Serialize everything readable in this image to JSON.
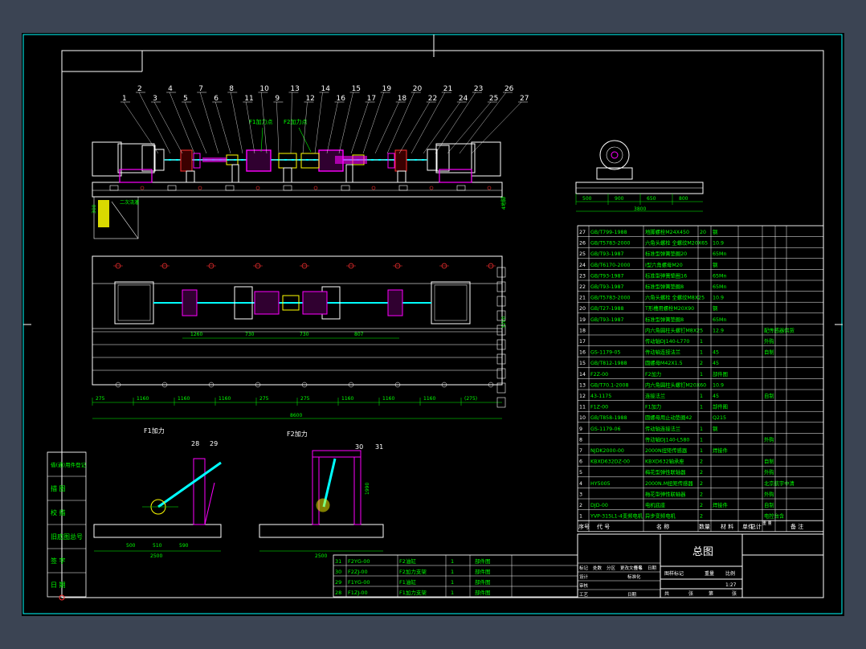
{
  "colors": {
    "background": "#000000",
    "border": "#ffffff",
    "annotation": "#00ff00",
    "balloon": "#ffff00",
    "hatch": "#ffff00",
    "flange": "#ff00ff",
    "frame_cyan": "#00ffff",
    "red": "#ff3030"
  },
  "balloons": [
    "1",
    "2",
    "3",
    "4",
    "5",
    "7",
    "6",
    "8",
    "11",
    "10",
    "9",
    "13",
    "12",
    "14",
    "16",
    "15",
    "17",
    "19",
    "18",
    "20",
    "22",
    "21",
    "24",
    "23",
    "25",
    "26",
    "27"
  ],
  "annotations": {
    "f1_load_point": "F1加力点",
    "f2_load_point": "F2加力点",
    "second_pour": "二次浇灌",
    "base_label": "300",
    "wall_label": "4地脚"
  },
  "dims_side": [
    "500",
    "900",
    "650",
    "800"
  ],
  "dims_side_total": "3800",
  "dims_plan_top": [
    "1260",
    "730",
    "730",
    "807"
  ],
  "dims_plan_bottom": [
    "275",
    "1160",
    "1160",
    "1160",
    "275",
    "275",
    "1160",
    "1160",
    "1160",
    "(275)"
  ],
  "dims_plan_total": "8600",
  "dims_plan_right": "3200",
  "f1_view": {
    "title": "F1加力",
    "balloons": [
      "28",
      "29"
    ],
    "dims": [
      "500",
      "510",
      "590"
    ],
    "total": "2500"
  },
  "f2_view": {
    "title": "F2加力",
    "balloons": [
      "30",
      "31"
    ],
    "height": "1990",
    "total": "2500"
  },
  "left_block": [
    "借(通)用件登记",
    "描  图",
    "校  描",
    "旧底图总号",
    "签  字",
    "日  期"
  ],
  "bom_rows": [
    {
      "no": "27",
      "code": "GB/T799-1988",
      "name": "地脚螺栓M24X450",
      "qty": "20",
      "mat": "钢",
      "note1": "",
      "note2": ""
    },
    {
      "no": "26",
      "code": "GB/T5783-2000",
      "name": "六角头螺栓 全螺纹M20X65",
      "qty": "",
      "mat": "10.9",
      "note1": "",
      "note2": ""
    },
    {
      "no": "25",
      "code": "GB/T93-1987",
      "name": "标准型弹簧垫圈20",
      "qty": "",
      "mat": "65Mn",
      "note1": "",
      "note2": ""
    },
    {
      "no": "24",
      "code": "GB/T6170-2000",
      "name": "I型六角螺母M20",
      "qty": "",
      "mat": "钢",
      "note1": "",
      "note2": ""
    },
    {
      "no": "23",
      "code": "GB/T93-1987",
      "name": "标准型弹簧垫圈16",
      "qty": "",
      "mat": "65Mn",
      "note1": "",
      "note2": ""
    },
    {
      "no": "22",
      "code": "GB/T93-1987",
      "name": "标准型弹簧垫圈8",
      "qty": "",
      "mat": "65Mn",
      "note1": "",
      "note2": ""
    },
    {
      "no": "21",
      "code": "GB/T5783-2000",
      "name": "六角头螺栓 全螺纹M8X25",
      "qty": "",
      "mat": "10.9",
      "note1": "",
      "note2": ""
    },
    {
      "no": "20",
      "code": "GB/T27-1988",
      "name": "T形槽用螺栓M20X90",
      "qty": "",
      "mat": "钢",
      "note1": "",
      "note2": ""
    },
    {
      "no": "19",
      "code": "GB/T93-1987",
      "name": "标准型弹簧垫圈8",
      "qty": "",
      "mat": "65Mn",
      "note1": "",
      "note2": ""
    },
    {
      "no": "18",
      "code": "",
      "name": "内六角圆柱头螺钉M8X25",
      "qty": "",
      "mat": "12.9",
      "note1": "",
      "note2": "配传感器供货"
    },
    {
      "no": "17",
      "code": "",
      "name": "传动轴DJ140-L770",
      "qty": "1",
      "mat": "",
      "note1": "",
      "note2": "外购"
    },
    {
      "no": "16",
      "code": "GS-1179-05",
      "name": "传动轴连接法兰",
      "qty": "1",
      "mat": "45",
      "note1": "",
      "note2": "自制"
    },
    {
      "no": "15",
      "code": "GB/T812-1988",
      "name": "圆螺母M42X1.5",
      "qty": "2",
      "mat": "45",
      "note1": "",
      "note2": ""
    },
    {
      "no": "14",
      "code": "F2Z-00",
      "name": "F2加力",
      "qty": "1",
      "mat": "部件图",
      "note1": "",
      "note2": ""
    },
    {
      "no": "13",
      "code": "GB/T70.1-2008",
      "name": "内六角圆柱头螺钉M20X60",
      "qty": "",
      "mat": "10.9",
      "note1": "",
      "note2": ""
    },
    {
      "no": "12",
      "code": "43-1175",
      "name": "连接法兰",
      "qty": "1",
      "mat": "45",
      "note1": "",
      "note2": "自制"
    },
    {
      "no": "11",
      "code": "F1Z-00",
      "name": "F1加力",
      "qty": "1",
      "mat": "部件图",
      "note1": "",
      "note2": ""
    },
    {
      "no": "10",
      "code": "GB/T858-1988",
      "name": "圆螺母用止动垫圈42",
      "qty": "",
      "mat": "Q215",
      "note1": "",
      "note2": ""
    },
    {
      "no": "9",
      "code": "GS-1179-06",
      "name": "传动轴连接法兰",
      "qty": "1",
      "mat": "钢",
      "note1": "",
      "note2": ""
    },
    {
      "no": "8",
      "code": "",
      "name": "传动轴DJ140-L580",
      "qty": "1",
      "mat": "",
      "note1": "",
      "note2": "外购"
    },
    {
      "no": "7",
      "code": "NJDK2000-00",
      "name": "2000N扭矩传感器",
      "qty": "1",
      "mat": "焊接件",
      "note1": "",
      "note2": ""
    },
    {
      "no": "6",
      "code": "KBXD632DZ-00",
      "name": "KBXD632轴承座",
      "qty": "2",
      "mat": "",
      "note1": "",
      "note2": "自制"
    },
    {
      "no": "5",
      "code": "",
      "name": "梅花型弹性联轴器",
      "qty": "2",
      "mat": "",
      "note1": "",
      "note2": "外购"
    },
    {
      "no": "4",
      "code": "HY5005",
      "name": "2000N.M扭矩传感器",
      "qty": "2",
      "mat": "",
      "note1": "",
      "note2": "北京航宇中清"
    },
    {
      "no": "3",
      "code": "",
      "name": "梅花型弹性联轴器",
      "qty": "2",
      "mat": "",
      "note1": "",
      "note2": "外购"
    },
    {
      "no": "2",
      "code": "DJD-00",
      "name": "电机底座",
      "qty": "2",
      "mat": "焊接件",
      "note1": "",
      "note2": "自制"
    },
    {
      "no": "1",
      "code": "YVP-315L1-4变频电机",
      "name": "异步变频电机",
      "qty": "2",
      "mat": "",
      "note1": "",
      "note2": "电控台含"
    }
  ],
  "bom_header": {
    "no": "序号",
    "code": "代  号",
    "name": "名  称",
    "qty": "数量",
    "mat": "材  料",
    "w1": "单件",
    "w2": "总计",
    "weight": "重 量",
    "note": "备  注"
  },
  "small_bom": [
    {
      "no": "31",
      "code": "F2YG-00",
      "name": "F2油缸",
      "qty": "1",
      "mat": "部件图"
    },
    {
      "no": "30",
      "code": "F2ZJ-00",
      "name": "F2加力支架",
      "qty": "1",
      "mat": "部件图"
    },
    {
      "no": "29",
      "code": "F1YG-00",
      "name": "F1油缸",
      "qty": "1",
      "mat": "部件图"
    },
    {
      "no": "28",
      "code": "F1ZJ-00",
      "name": "F1加力支架",
      "qty": "1",
      "mat": "部件图"
    }
  ],
  "title_block": {
    "title": "总图",
    "scale": "1:27",
    "marks": "图样标记",
    "weight": "重量",
    "ratio": "比例",
    "sheet_a": "共",
    "sheet_b": "张",
    "sheet_c": "第",
    "sheet_d": "张",
    "row1": [
      "标记",
      "处数",
      "分区",
      "更改文件号",
      "签名",
      "日期"
    ],
    "row2": [
      "设计",
      "",
      "标准化"
    ],
    "row3": [
      "审核",
      ""
    ],
    "row4": [
      "工艺",
      "",
      "日期"
    ]
  }
}
